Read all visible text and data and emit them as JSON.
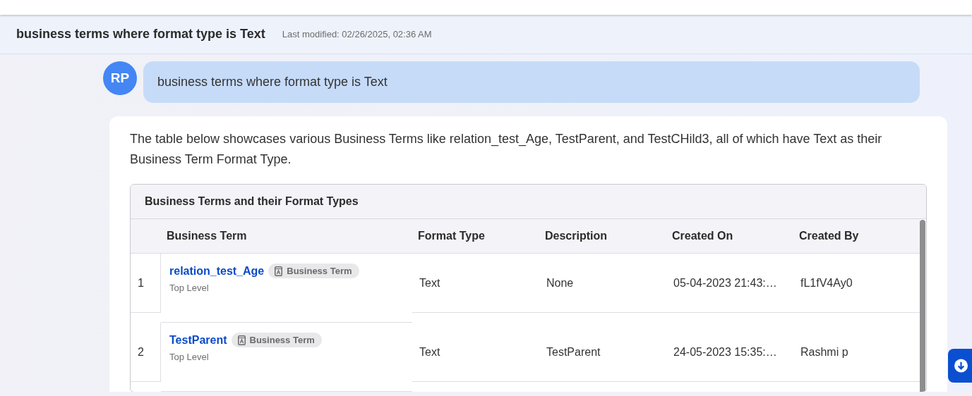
{
  "header": {
    "title": "business terms where format type is Text",
    "last_modified": "Last modified: 02/26/2025, 02:36 AM"
  },
  "user_message": {
    "initials": "RP",
    "text": "business terms where format type is Text"
  },
  "assistant_message": {
    "text": "The table below showcases various Business Terms like relation_test_Age, TestParent, and TestCHild3, all of which have Text as their Business Term Format Type.",
    "table": {
      "title": "Business Terms and their Format Types",
      "columns": [
        "Business Term",
        "Format Type",
        "Description",
        "Created On",
        "Created By"
      ],
      "rows": [
        {
          "index": "1",
          "term": "relation_test_Age",
          "badge": "Business Term",
          "level": "Top Level",
          "format_type": "Text",
          "description": "None",
          "created_on": "05-04-2023 21:43:…",
          "created_by": "fL1fV4Ay0"
        },
        {
          "index": "2",
          "term": "TestParent",
          "badge": "Business Term",
          "level": "Top Level",
          "format_type": "Text",
          "description": "TestParent",
          "created_on": "24-05-2023 15:35:…",
          "created_by": "Rashmi p"
        }
      ]
    }
  }
}
